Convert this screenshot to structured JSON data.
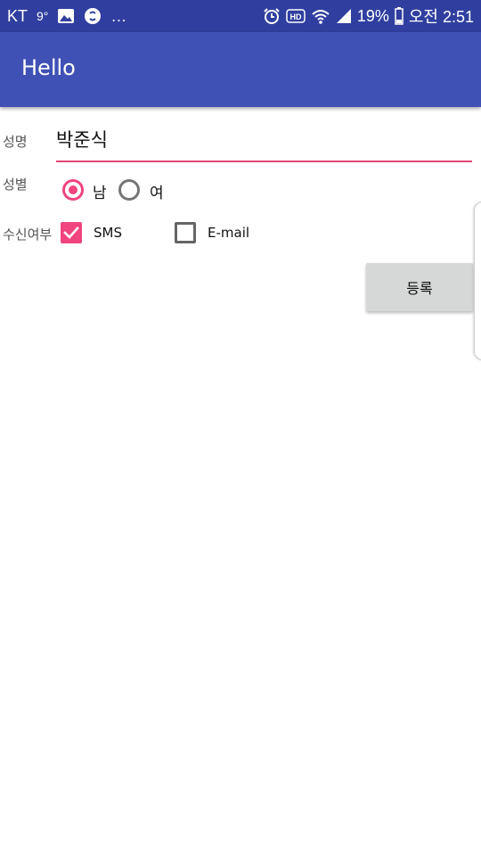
{
  "status_bar": {
    "carrier": "KT",
    "notif_temp": "9°",
    "more": "…",
    "battery": "19%",
    "time": "오전 2:51",
    "icons": [
      "image-icon",
      "shazam-icon",
      "alarm-icon",
      "hd-icon",
      "wifi-icon",
      "signal-icon",
      "battery-icon"
    ]
  },
  "app_bar": {
    "title": "Hello"
  },
  "form": {
    "name_label": "성명",
    "name_value": "박준식",
    "gender_label": "성별",
    "gender_options": [
      "남",
      "여"
    ],
    "gender_selected": "남",
    "receive_label": "수신여부",
    "receive_options": [
      {
        "label": "SMS",
        "checked": true
      },
      {
        "label": "E-mail",
        "checked": false
      }
    ],
    "submit_label": "등록"
  },
  "colors": {
    "status_bar": "#303f9f",
    "app_bar": "#3f51b5",
    "accent": "#f0457e",
    "button": "#d6d7d7"
  }
}
